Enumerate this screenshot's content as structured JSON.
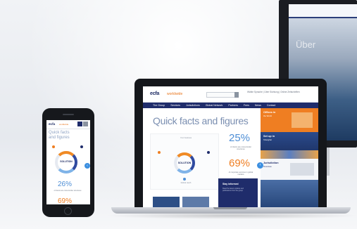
{
  "scene": {
    "colors": {
      "brand_navy": "#1f2c6b",
      "brand_orange": "#ef7e22",
      "accent_blue": "#4f8fd6",
      "heading_blue": "#7b8fb1",
      "device_black": "#15171b"
    }
  },
  "background_monitor": {
    "hero_text": "Über"
  },
  "laptop_site": {
    "logo": "ecfa",
    "logo_sub": "worldwide",
    "top_links": "Wähle Sprache | Über Sichtung | Online Zeitschriften",
    "nav": [
      "The Group",
      "Services",
      "Jurisdictions",
      "Global Network",
      "Partners",
      "Fees",
      "News",
      "Contact"
    ],
    "heading": "Quick facts and figures",
    "diagram": {
      "center_label": "SOLUTION",
      "top_caption": "Your business",
      "bottom_caption": "Global reach"
    },
    "stats": [
      {
        "value": "25%",
        "text": "of clients are cross-border structures"
      },
      {
        "value": "69%",
        "text": "of corporate services in global markets"
      }
    ],
    "featured": {
      "title": "Stay informed",
      "text": "Read the latest updates and publications from the group"
    },
    "side_cards": [
      {
        "title": "Offices in",
        "sub": "the World"
      },
      {
        "title": "Set up in",
        "sub": "Shanghai"
      },
      {
        "title": "Jurisdiction",
        "sub": "Overview"
      }
    ],
    "arrow_glyph": "‹"
  },
  "phone_site": {
    "logo": "ecfa",
    "logo_sub": "worldwide",
    "heading": "Quick facts and figures",
    "ring_label": "SOLUTION",
    "stats": [
      {
        "value": "26%",
        "text": "of clients are cross-border structures"
      },
      {
        "value": "69%",
        "text": "of corporate services"
      }
    ],
    "arrow_glyph": "‹"
  },
  "icons": [
    "search-icon",
    "menu-icon",
    "chevron-left-icon"
  ]
}
